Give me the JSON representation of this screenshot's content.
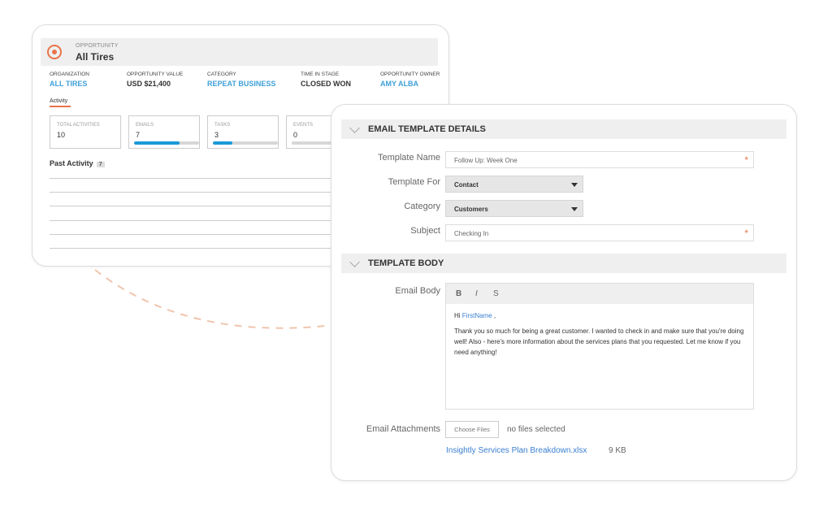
{
  "opportunity": {
    "label": "OPPORTUNITY",
    "title": "All Tires",
    "fields": [
      {
        "key": "ORGANIZATION",
        "value": "ALL TIRES",
        "link": true
      },
      {
        "key": "OPPORTUNITY VALUE",
        "value": "USD $21,400",
        "link": false
      },
      {
        "key": "CATEGORY",
        "value": "REPEAT BUSINESS",
        "link": true
      },
      {
        "key": "TIME IN STAGE",
        "value": "CLOSED WON",
        "link": false
      },
      {
        "key": "OPPORTUNITY OWNER",
        "value": "AMY ALBA",
        "link": true
      }
    ],
    "activity_tab": "Activity",
    "stats": [
      {
        "label": "TOTAL ACTIVITIES",
        "value": "10"
      },
      {
        "label": "EMAILS",
        "value": "7",
        "progress": 0.7
      },
      {
        "label": "TASKS",
        "value": "3",
        "progress": 0.3
      },
      {
        "label": "EVENTS",
        "value": "0",
        "progress": 0
      }
    ],
    "past_activity": {
      "label": "Past Activity",
      "count": "7"
    }
  },
  "email_template": {
    "details_section": "EMAIL TEMPLATE DETAILS",
    "template_name": {
      "label": "Template Name",
      "value": "Follow Up: Week One",
      "required": "*"
    },
    "template_for": {
      "label": "Template For",
      "value": "Contact"
    },
    "category": {
      "label": "Category",
      "value": "Customers"
    },
    "subject": {
      "label": "Subject",
      "value": "Checking In",
      "required": "*"
    },
    "body_section": "TEMPLATE BODY",
    "email_body": {
      "label": "Email Body",
      "toolbar": {
        "bold": "B",
        "italic": "I",
        "strike": "S"
      },
      "greeting": "Hi",
      "merge_field": "FirstName",
      "greeting_suffix": ",",
      "text": "Thank you so much for being a great customer. I wanted to check in and make sure that you're doing well! Also - here's more information about the services plans that you requested. Let me know if you need anything!"
    },
    "attachments": {
      "label": "Email Attachments",
      "button": "Choose Files",
      "status": "no files selected",
      "file_name": "Insightly Services Plan Breakdown.xlsx",
      "file_size": "9 KB"
    }
  },
  "colors": {
    "accent": "#e8744a",
    "link": "#3fa0d8",
    "progress": "#1a9ad6"
  }
}
